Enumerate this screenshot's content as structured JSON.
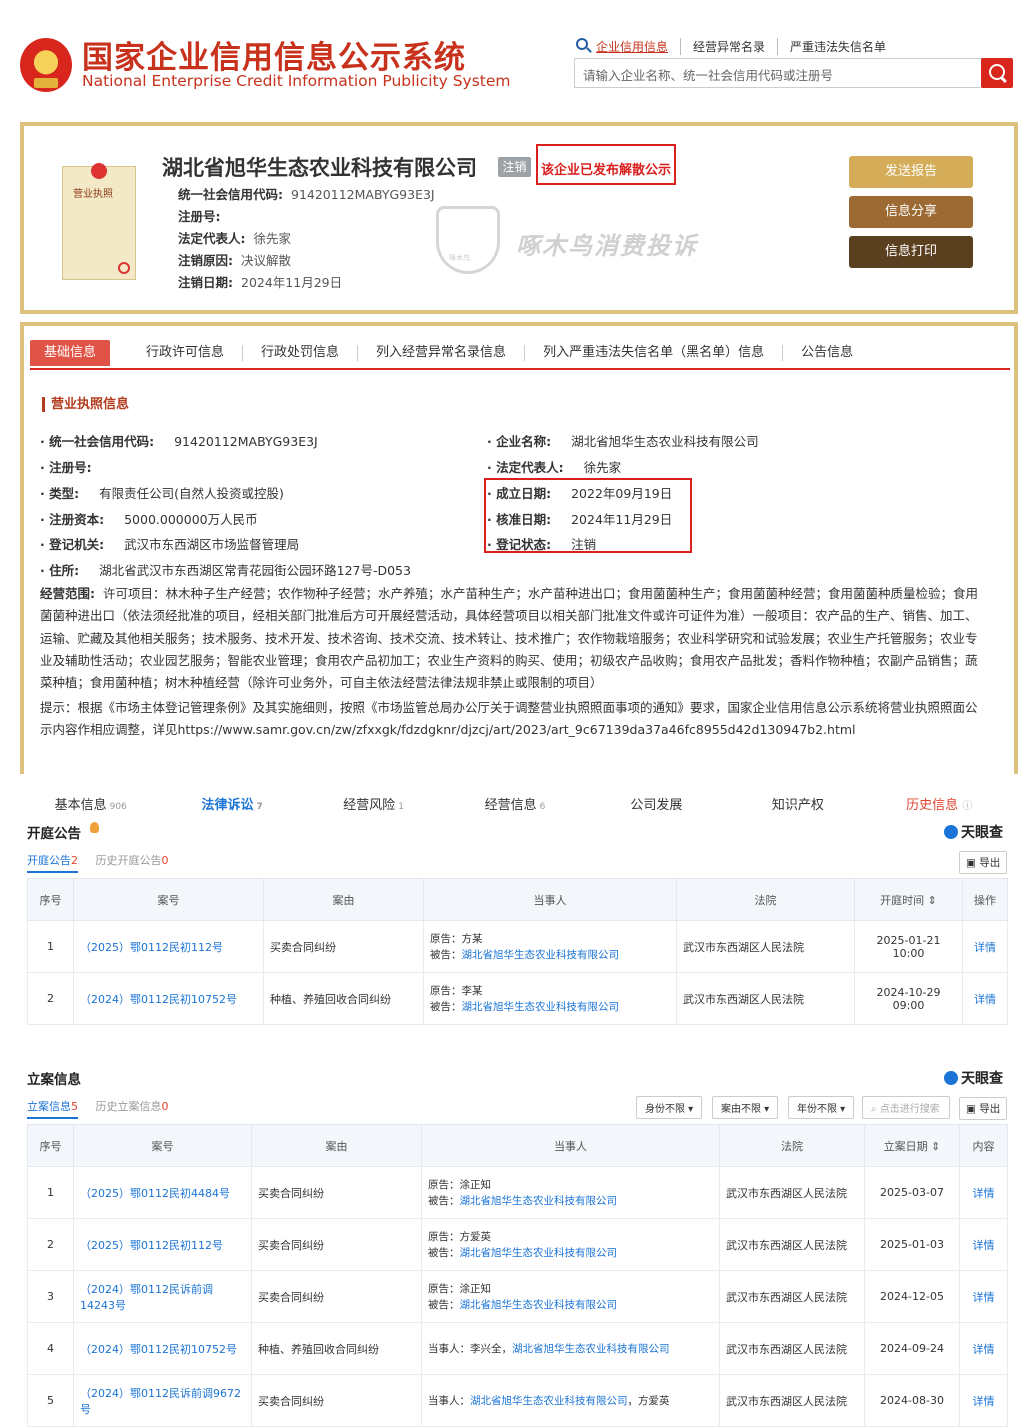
{
  "header": {
    "site_title_cn": "国家企业信用信息公示系统",
    "site_title_en": "National Enterprise Credit Information Publicity System",
    "links": [
      "企业信用信息",
      "经营异常名录",
      "严重违法失信名单"
    ],
    "search_placeholder": "请输入企业名称、统一社会信用代码或注册号"
  },
  "company": {
    "license_label": "营业执照",
    "name": "湖北省旭华生态农业科技有限公司",
    "status_badge": "注销",
    "dissolution_notice": "该企业已发布解散公示",
    "fields": [
      {
        "label": "统一社会信用代码:",
        "value": "91420112MABYG93E3J"
      },
      {
        "label": "注册号:",
        "value": ""
      },
      {
        "label": "法定代表人:",
        "value": "徐先家"
      },
      {
        "label": "注销原因:",
        "value": "决议解散"
      },
      {
        "label": "注销日期:",
        "value": "2024年11月29日"
      }
    ],
    "buttons": [
      "发送报告",
      "信息分享",
      "信息打印"
    ],
    "watermark": "啄木鸟消费投诉",
    "watermark_badge": "啄木鸟"
  },
  "tabs": [
    "基础信息",
    "行政许可信息",
    "行政处罚信息",
    "列入经营异常名录信息",
    "列入严重违法失信名单（黑名单）信息",
    "公告信息"
  ],
  "license_info": {
    "title": "营业执照信息",
    "left": [
      {
        "label": "统一社会信用代码:",
        "value": "91420112MABYG93E3J"
      },
      {
        "label": "注册号:",
        "value": ""
      },
      {
        "label": "类型:",
        "value": "有限责任公司(自然人投资或控股)"
      },
      {
        "label": "注册资本:",
        "value": "5000.000000万人民币"
      },
      {
        "label": "登记机关:",
        "value": "武汉市东西湖区市场监督管理局"
      },
      {
        "label": "住所:",
        "value": "湖北省武汉市东西湖区常青花园街公园环路127号-D053"
      }
    ],
    "right": [
      {
        "label": "企业名称:",
        "value": "湖北省旭华生态农业科技有限公司"
      },
      {
        "label": "法定代表人:",
        "value": "徐先家"
      },
      {
        "label": "成立日期:",
        "value": "2022年09月19日"
      },
      {
        "label": "核准日期:",
        "value": "2024年11月29日"
      },
      {
        "label": "登记状态:",
        "value": "注销"
      }
    ],
    "scope_label": "经营范围:",
    "scope_text": "许可项目：林木种子生产经营；农作物种子经营；水产养殖；水产苗种生产；水产苗种进出口；食用菌菌种生产；食用菌菌种经营；食用菌菌种质量检验；食用菌菌种进出口（依法须经批准的项目，经相关部门批准后方可开展经营活动，具体经营项目以相关部门批准文件或许可证件为准）一般项目：农产品的生产、销售、加工、运输、贮藏及其他相关服务；技术服务、技术开发、技术咨询、技术交流、技术转让、技术推广；农作物栽培服务；农业科学研究和试验发展；农业生产托管服务；农业专业及辅助性活动；农业园艺服务；智能农业管理；食用农产品初加工；农业生产资料的购买、使用；初级农产品收购；食用农产品批发；香料作物种植；农副产品销售；蔬菜种植；食用菌种植；树木种植经营（除许可业务外，可自主依法经营法律法规非禁止或限制的项目）",
    "tip": "提示：根据《市场主体登记管理条例》及其实施细则，按照《市场监管总局办公厅关于调整营业执照照面事项的通知》要求，国家企业信用信息公示系统将营业执照照面公示内容作相应调整，详见https://www.samr.gov.cn/zw/zfxxgk/fdzdgknr/djzcj/art/2023/art_9c67139da37a46fc8955d42d130947b2.html"
  },
  "tyc_nav": [
    {
      "label": "基本信息",
      "count": "906"
    },
    {
      "label": "法律诉讼",
      "count": "7"
    },
    {
      "label": "经营风险",
      "count": "1"
    },
    {
      "label": "经营信息",
      "count": "6"
    },
    {
      "label": "公司发展",
      "count": ""
    },
    {
      "label": "知识产权",
      "count": ""
    },
    {
      "label": "历史信息",
      "count": ""
    }
  ],
  "hearing": {
    "title": "开庭公告",
    "logo": "天眼查",
    "tab_active": "开庭公告",
    "tab_active_count": "2",
    "tab_history": "历史开庭公告",
    "tab_history_count": "0",
    "export": "导出",
    "columns": [
      "序号",
      "案号",
      "案由",
      "当事人",
      "法院",
      "开庭时间",
      "操作"
    ],
    "rows": [
      {
        "no": "1",
        "case": "（2025）鄂0112民初112号",
        "cause": "买卖合同纠纷",
        "p1": "原告：方某",
        "p2l": "被告：",
        "p2": "湖北省旭华生态农业科技有限公司",
        "court": "武汉市东西湖区人民法院",
        "date": "2025-01-21 10:00",
        "op": "详情"
      },
      {
        "no": "2",
        "case": "（2024）鄂0112民初10752号",
        "cause": "种植、养殖回收合同纠纷",
        "p1": "原告：李某",
        "p2l": "被告：",
        "p2": "湖北省旭华生态农业科技有限公司",
        "court": "武汉市东西湖区人民法院",
        "date": "2024-10-29 09:00",
        "op": "详情"
      }
    ]
  },
  "filing": {
    "title": "立案信息",
    "logo": "天眼查",
    "tab_active": "立案信息",
    "tab_active_count": "5",
    "tab_history": "历史立案信息",
    "tab_history_count": "0",
    "filters": [
      "身份不限",
      "案由不限",
      "年份不限"
    ],
    "search_placeholder": "点击进行搜索",
    "export": "导出",
    "columns": [
      "序号",
      "案号",
      "案由",
      "当事人",
      "法院",
      "立案日期",
      "内容"
    ],
    "rows": [
      {
        "no": "1",
        "case": "（2025）鄂0112民初4484号",
        "cause": "买卖合同纠纷",
        "p1": "原告：涂正知",
        "p2l": "被告：",
        "p2": "湖北省旭华生态农业科技有限公司",
        "court": "武汉市东西湖区人民法院",
        "date": "2025-03-07",
        "op": "详情"
      },
      {
        "no": "2",
        "case": "（2025）鄂0112民初112号",
        "cause": "买卖合同纠纷",
        "p1": "原告：方爱英",
        "p2l": "被告：",
        "p2": "湖北省旭华生态农业科技有限公司",
        "court": "武汉市东西湖区人民法院",
        "date": "2025-01-03",
        "op": "详情"
      },
      {
        "no": "3",
        "case": "（2024）鄂0112民诉前调14243号",
        "cause": "买卖合同纠纷",
        "p1": "原告：涂正知",
        "p2l": "被告：",
        "p2": "湖北省旭华生态农业科技有限公司",
        "court": "武汉市东西湖区人民法院",
        "date": "2024-12-05",
        "op": "详情"
      },
      {
        "no": "4",
        "case": "（2024）鄂0112民初10752号",
        "cause": "种植、养殖回收合同纠纷",
        "p1": "当事人：李兴全，",
        "p2l": "",
        "p2": "湖北省旭华生态农业科技有限公司",
        "court": "武汉市东西湖区人民法院",
        "date": "2024-09-24",
        "op": "详情"
      },
      {
        "no": "5",
        "case": "（2024）鄂0112民诉前调9672号",
        "cause": "买卖合同纠纷",
        "p1": "当事人：",
        "p2l": "",
        "p2": "湖北省旭华生态农业科技有限公司",
        "p3": "，方爱英",
        "court": "武汉市东西湖区人民法院",
        "date": "2024-08-30",
        "op": "详情"
      }
    ]
  },
  "colors": {
    "brand_red": "#c8321c",
    "gold_border": "#dcc27c",
    "link_blue": "#1b74d6",
    "alert_red": "#d9201f"
  }
}
